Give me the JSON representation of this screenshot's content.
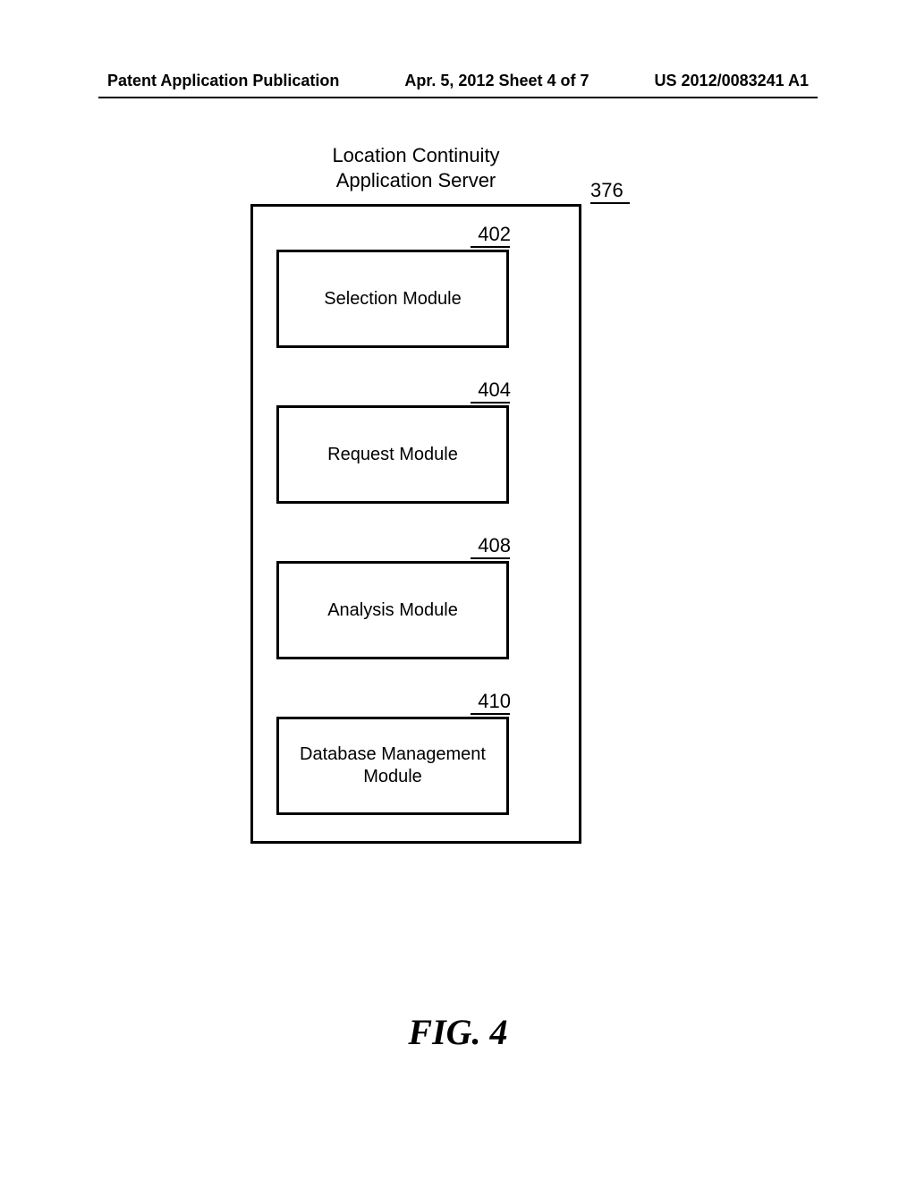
{
  "header": {
    "left": "Patent Application Publication",
    "center": "Apr. 5, 2012  Sheet 4 of 7",
    "right": "US 2012/0083241 A1"
  },
  "diagram": {
    "title_line1": "Location Continuity",
    "title_line2": "Application Server",
    "server_ref": "376",
    "modules": [
      {
        "ref": "402",
        "label": "Selection Module"
      },
      {
        "ref": "404",
        "label": "Request Module"
      },
      {
        "ref": "408",
        "label": "Analysis Module"
      },
      {
        "ref": "410",
        "label": "Database Management Module"
      }
    ]
  },
  "figure_label": "FIG. 4"
}
